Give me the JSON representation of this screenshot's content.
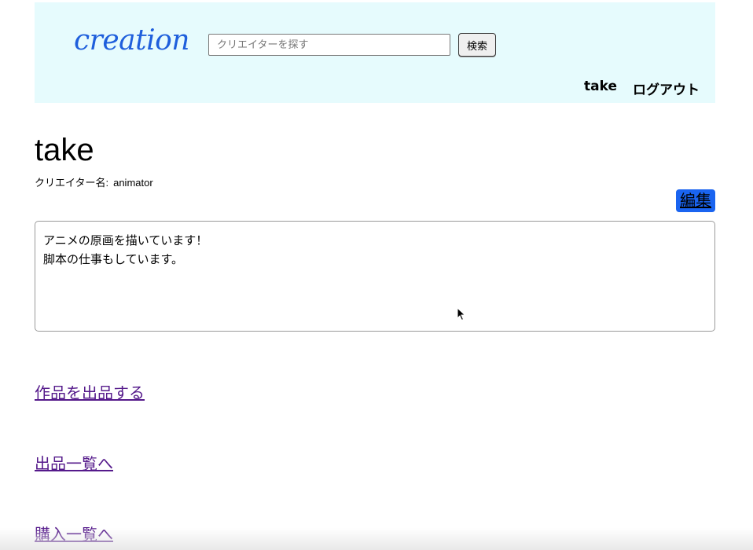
{
  "header": {
    "logo": "creation",
    "search": {
      "placeholder": "クリエイターを探す",
      "value": "",
      "button_label": "検索"
    },
    "nav": {
      "user_label": "take",
      "logout_label": "ログアウト"
    }
  },
  "profile": {
    "name": "take",
    "creator_label": "クリエイター名:",
    "creator_value": "animator",
    "edit_label": "編集",
    "bio": "アニメの原画を描いています！\n脚本の仕事もしています。"
  },
  "links": [
    {
      "label": "作品を出品する"
    },
    {
      "label": "出品一覧へ"
    },
    {
      "label": "購入一覧へ"
    }
  ],
  "colors": {
    "header_bg": "#e6fbfd",
    "logo": "#1f5fdc",
    "edit_button": "#1a64f0",
    "visited_link": "#551a8b"
  }
}
